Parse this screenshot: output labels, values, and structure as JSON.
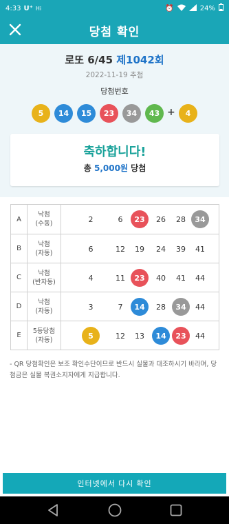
{
  "status_bar": {
    "time": "4:33",
    "carrier": "U⁺",
    "network": "Hi",
    "battery": "24%"
  },
  "app_bar": {
    "close_icon": "close-icon",
    "title": "당첨 확인"
  },
  "summary": {
    "game": "로또 6/45",
    "round": "제1042회",
    "draw_date": "2022-11-19 추첨",
    "winning_label": "당첨번호",
    "winning_numbers": [
      {
        "value": "5",
        "color": "#e8b21a"
      },
      {
        "value": "14",
        "color": "#2e8bd8"
      },
      {
        "value": "15",
        "color": "#2e8bd8"
      },
      {
        "value": "23",
        "color": "#e8525a"
      },
      {
        "value": "34",
        "color": "#999999"
      },
      {
        "value": "43",
        "color": "#60b84e"
      }
    ],
    "plus": "+",
    "bonus": {
      "value": "4",
      "color": "#e8b21a"
    }
  },
  "result": {
    "headline": "축하합니다!",
    "prize_prefix": "총",
    "prize_amount": "5,000원",
    "prize_suffix": "당첨"
  },
  "rows": [
    {
      "label": "A",
      "type1": "낙첨",
      "type2": "(수동)",
      "numbers": [
        {
          "value": "2"
        },
        {
          "value": "6"
        },
        {
          "value": "23",
          "color": "#e8525a"
        },
        {
          "value": "26"
        },
        {
          "value": "28"
        },
        {
          "value": "34",
          "color": "#999999"
        }
      ]
    },
    {
      "label": "B",
      "type1": "낙첨",
      "type2": "(자동)",
      "numbers": [
        {
          "value": "6"
        },
        {
          "value": "12"
        },
        {
          "value": "19"
        },
        {
          "value": "24"
        },
        {
          "value": "39"
        },
        {
          "value": "41"
        }
      ]
    },
    {
      "label": "C",
      "type1": "낙첨",
      "type2": "(반자동)",
      "numbers": [
        {
          "value": "4"
        },
        {
          "value": "11"
        },
        {
          "value": "23",
          "color": "#e8525a"
        },
        {
          "value": "40"
        },
        {
          "value": "41"
        },
        {
          "value": "44"
        }
      ]
    },
    {
      "label": "D",
      "type1": "낙첨",
      "type2": "(자동)",
      "numbers": [
        {
          "value": "3"
        },
        {
          "value": "7"
        },
        {
          "value": "14",
          "color": "#2e8bd8"
        },
        {
          "value": "28"
        },
        {
          "value": "34",
          "color": "#999999"
        },
        {
          "value": "44"
        }
      ]
    },
    {
      "label": "E",
      "type1": "5등당첨",
      "type2": "(자동)",
      "numbers": [
        {
          "value": "5",
          "color": "#e8b21a"
        },
        {
          "value": "12"
        },
        {
          "value": "13"
        },
        {
          "value": "14",
          "color": "#2e8bd8"
        },
        {
          "value": "23",
          "color": "#e8525a"
        },
        {
          "value": "44"
        }
      ]
    }
  ],
  "notice": "- QR 당첨확인은 보조 확인수단이므로 반드시 실물과 대조하시기 바라며, 당첨금은 실물 복권소지자에게 지급합니다.",
  "recheck_button": "인터넷에서 다시 확인",
  "nav": {
    "back_icon": "back-icon",
    "home_icon": "home-icon",
    "recents_icon": "recents-icon"
  }
}
